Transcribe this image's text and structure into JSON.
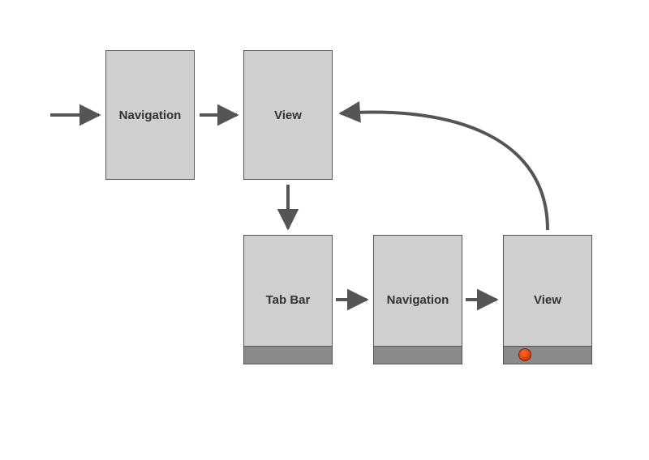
{
  "diagram": {
    "nodes": {
      "navigation_top": {
        "label": "Navigation"
      },
      "view_top": {
        "label": "View"
      },
      "tabbar": {
        "label": "Tab Bar"
      },
      "navigation_bot": {
        "label": "Navigation"
      },
      "view_bot": {
        "label": "View"
      }
    },
    "edges": [
      {
        "from": "entry",
        "to": "navigation_top"
      },
      {
        "from": "navigation_top",
        "to": "view_top"
      },
      {
        "from": "view_top",
        "to": "tabbar"
      },
      {
        "from": "tabbar",
        "to": "navigation_bot"
      },
      {
        "from": "navigation_bot",
        "to": "view_bot"
      },
      {
        "from": "view_bot",
        "to": "view_top",
        "curved": true
      }
    ],
    "colors": {
      "node_fill": "#cfcfcf",
      "node_stroke": "#555555",
      "tabbar_fill": "#8a8a8a",
      "arrow": "#555555",
      "dot": "#e34916"
    }
  }
}
